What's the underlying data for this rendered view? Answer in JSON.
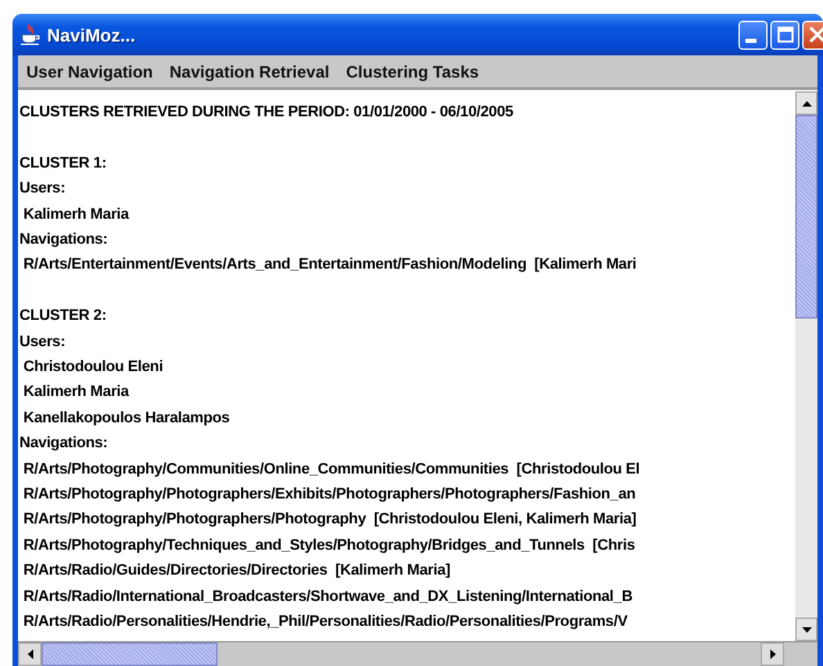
{
  "window": {
    "title": "NaviMoz..."
  },
  "menu": [
    {
      "label": "User Navigation"
    },
    {
      "label": "Navigation Retrieval"
    },
    {
      "label": "Clustering Tasks"
    }
  ],
  "content": {
    "header": "CLUSTERS RETRIEVED DURING THE PERIOD: 01/01/2000 - 06/10/2005",
    "clusters": [
      {
        "title": "CLUSTER 1:",
        "users_label": "Users:",
        "users": [
          "Kalimerh Maria"
        ],
        "navigations_label": "Navigations:",
        "navigations": [
          "R/Arts/Entertainment/Events/Arts_and_Entertainment/Fashion/Modeling  [Kalimerh Mari"
        ]
      },
      {
        "title": "CLUSTER 2:",
        "users_label": "Users:",
        "users": [
          "Christodoulou Eleni",
          "Kalimerh Maria",
          "Kanellakopoulos Haralampos"
        ],
        "navigations_label": "Navigations:",
        "navigations": [
          "R/Arts/Photography/Communities/Online_Communities/Communities  [Christodoulou El",
          "R/Arts/Photography/Photographers/Exhibits/Photographers/Photographers/Fashion_an",
          "R/Arts/Photography/Photographers/Photography  [Christodoulou Eleni, Kalimerh Maria]",
          "R/Arts/Photography/Techniques_and_Styles/Photography/Bridges_and_Tunnels  [Chris",
          "R/Arts/Radio/Guides/Directories/Directories  [Kalimerh Maria]",
          "R/Arts/Radio/International_Broadcasters/Shortwave_and_DX_Listening/International_B",
          "R/Arts/Radio/Personalities/Hendrie,_Phil/Personalities/Radio/Personalities/Programs/V"
        ]
      }
    ]
  }
}
